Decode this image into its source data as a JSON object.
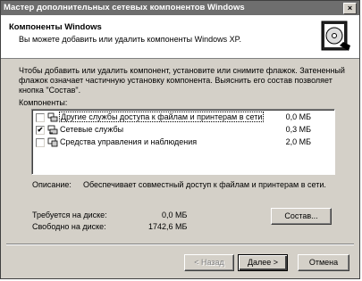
{
  "window": {
    "title": "Мастер дополнительных сетевых компонентов Windows",
    "close_glyph": "×"
  },
  "header": {
    "title": "Компоненты Windows",
    "subtitle": "Вы можете добавить или удалить компоненты Windows XP."
  },
  "description": "Чтобы добавить или удалить компонент, установите или снимите флажок. Затененный флажок означает частичную установку компонента. Выяснить его состав позволяет кнопка \"Состав\".",
  "components_label": "Компоненты:",
  "components": [
    {
      "name": "Другие службы доступа к файлам и принтерам в сети",
      "size": "0,0 МБ",
      "checked": false,
      "check_glyph": "",
      "selected": true,
      "icon": "network-printer-icon"
    },
    {
      "name": "Сетевые службы",
      "size": "0,3 МБ",
      "checked": true,
      "check_glyph": "✔",
      "selected": false,
      "icon": "network-services-icon"
    },
    {
      "name": "Средства управления и наблюдения",
      "size": "2,0 МБ",
      "checked": false,
      "check_glyph": "",
      "selected": false,
      "icon": "management-tools-icon"
    }
  ],
  "description_label": "Описание:",
  "description_value": "Обеспечивает совместный доступ к файлам и принтерам в сети.",
  "disk": {
    "required_label": "Требуется на диске:",
    "required_value": "0,0 МБ",
    "free_label": "Свободно на диске:",
    "free_value": "1742,6 МБ"
  },
  "buttons": {
    "details": "Состав...",
    "back": "< Назад",
    "next": "Далее >",
    "cancel": "Отмена"
  },
  "colors": {
    "titlebar": "#6e6e6e",
    "dialog_bg": "#d4d0c8"
  }
}
